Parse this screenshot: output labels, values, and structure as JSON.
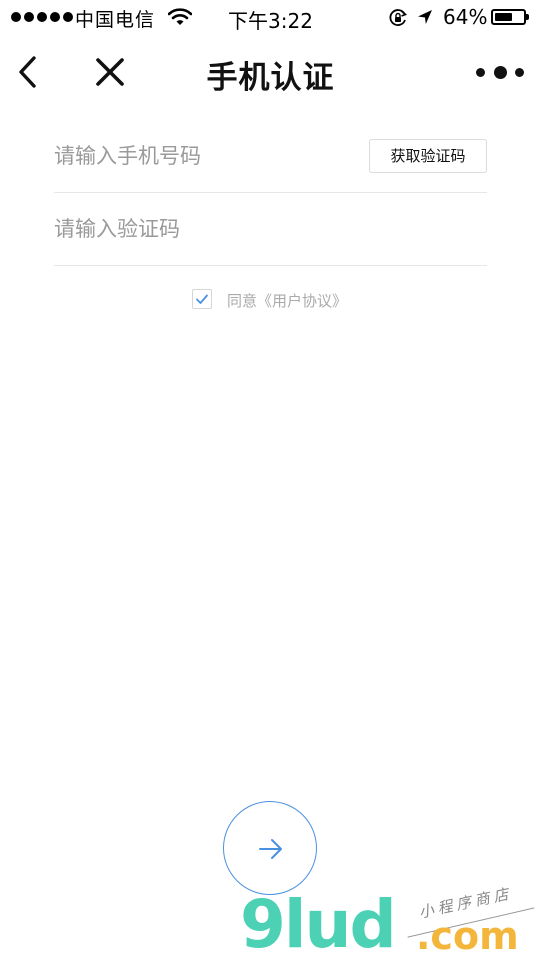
{
  "status_bar": {
    "carrier": "中国电信",
    "time": "下午3:22",
    "battery_percent": "64%",
    "battery_level": 0.64,
    "icons": [
      "signal-dots",
      "wifi-icon",
      "orientation-lock-icon",
      "location-arrow-icon",
      "battery-icon"
    ]
  },
  "nav": {
    "title": "手机认证",
    "icons": [
      "back-chevron-icon",
      "close-icon",
      "more-dots-icon"
    ]
  },
  "form": {
    "phone_placeholder": "请输入手机号码",
    "phone_value": "",
    "get_code_label": "获取验证码",
    "code_placeholder": "请输入验证码",
    "code_value": ""
  },
  "agreement": {
    "checked": true,
    "text": "同意《用户协议》"
  },
  "next_button": {
    "icon": "arrow-right-icon"
  },
  "watermark": {
    "brand": "9lud",
    "domain": ".com",
    "tagline": "小程序商店"
  },
  "colors": {
    "accent": "#4a90e2",
    "watermark_green": "#4cd1b5",
    "watermark_orange": "#f3b63a"
  }
}
